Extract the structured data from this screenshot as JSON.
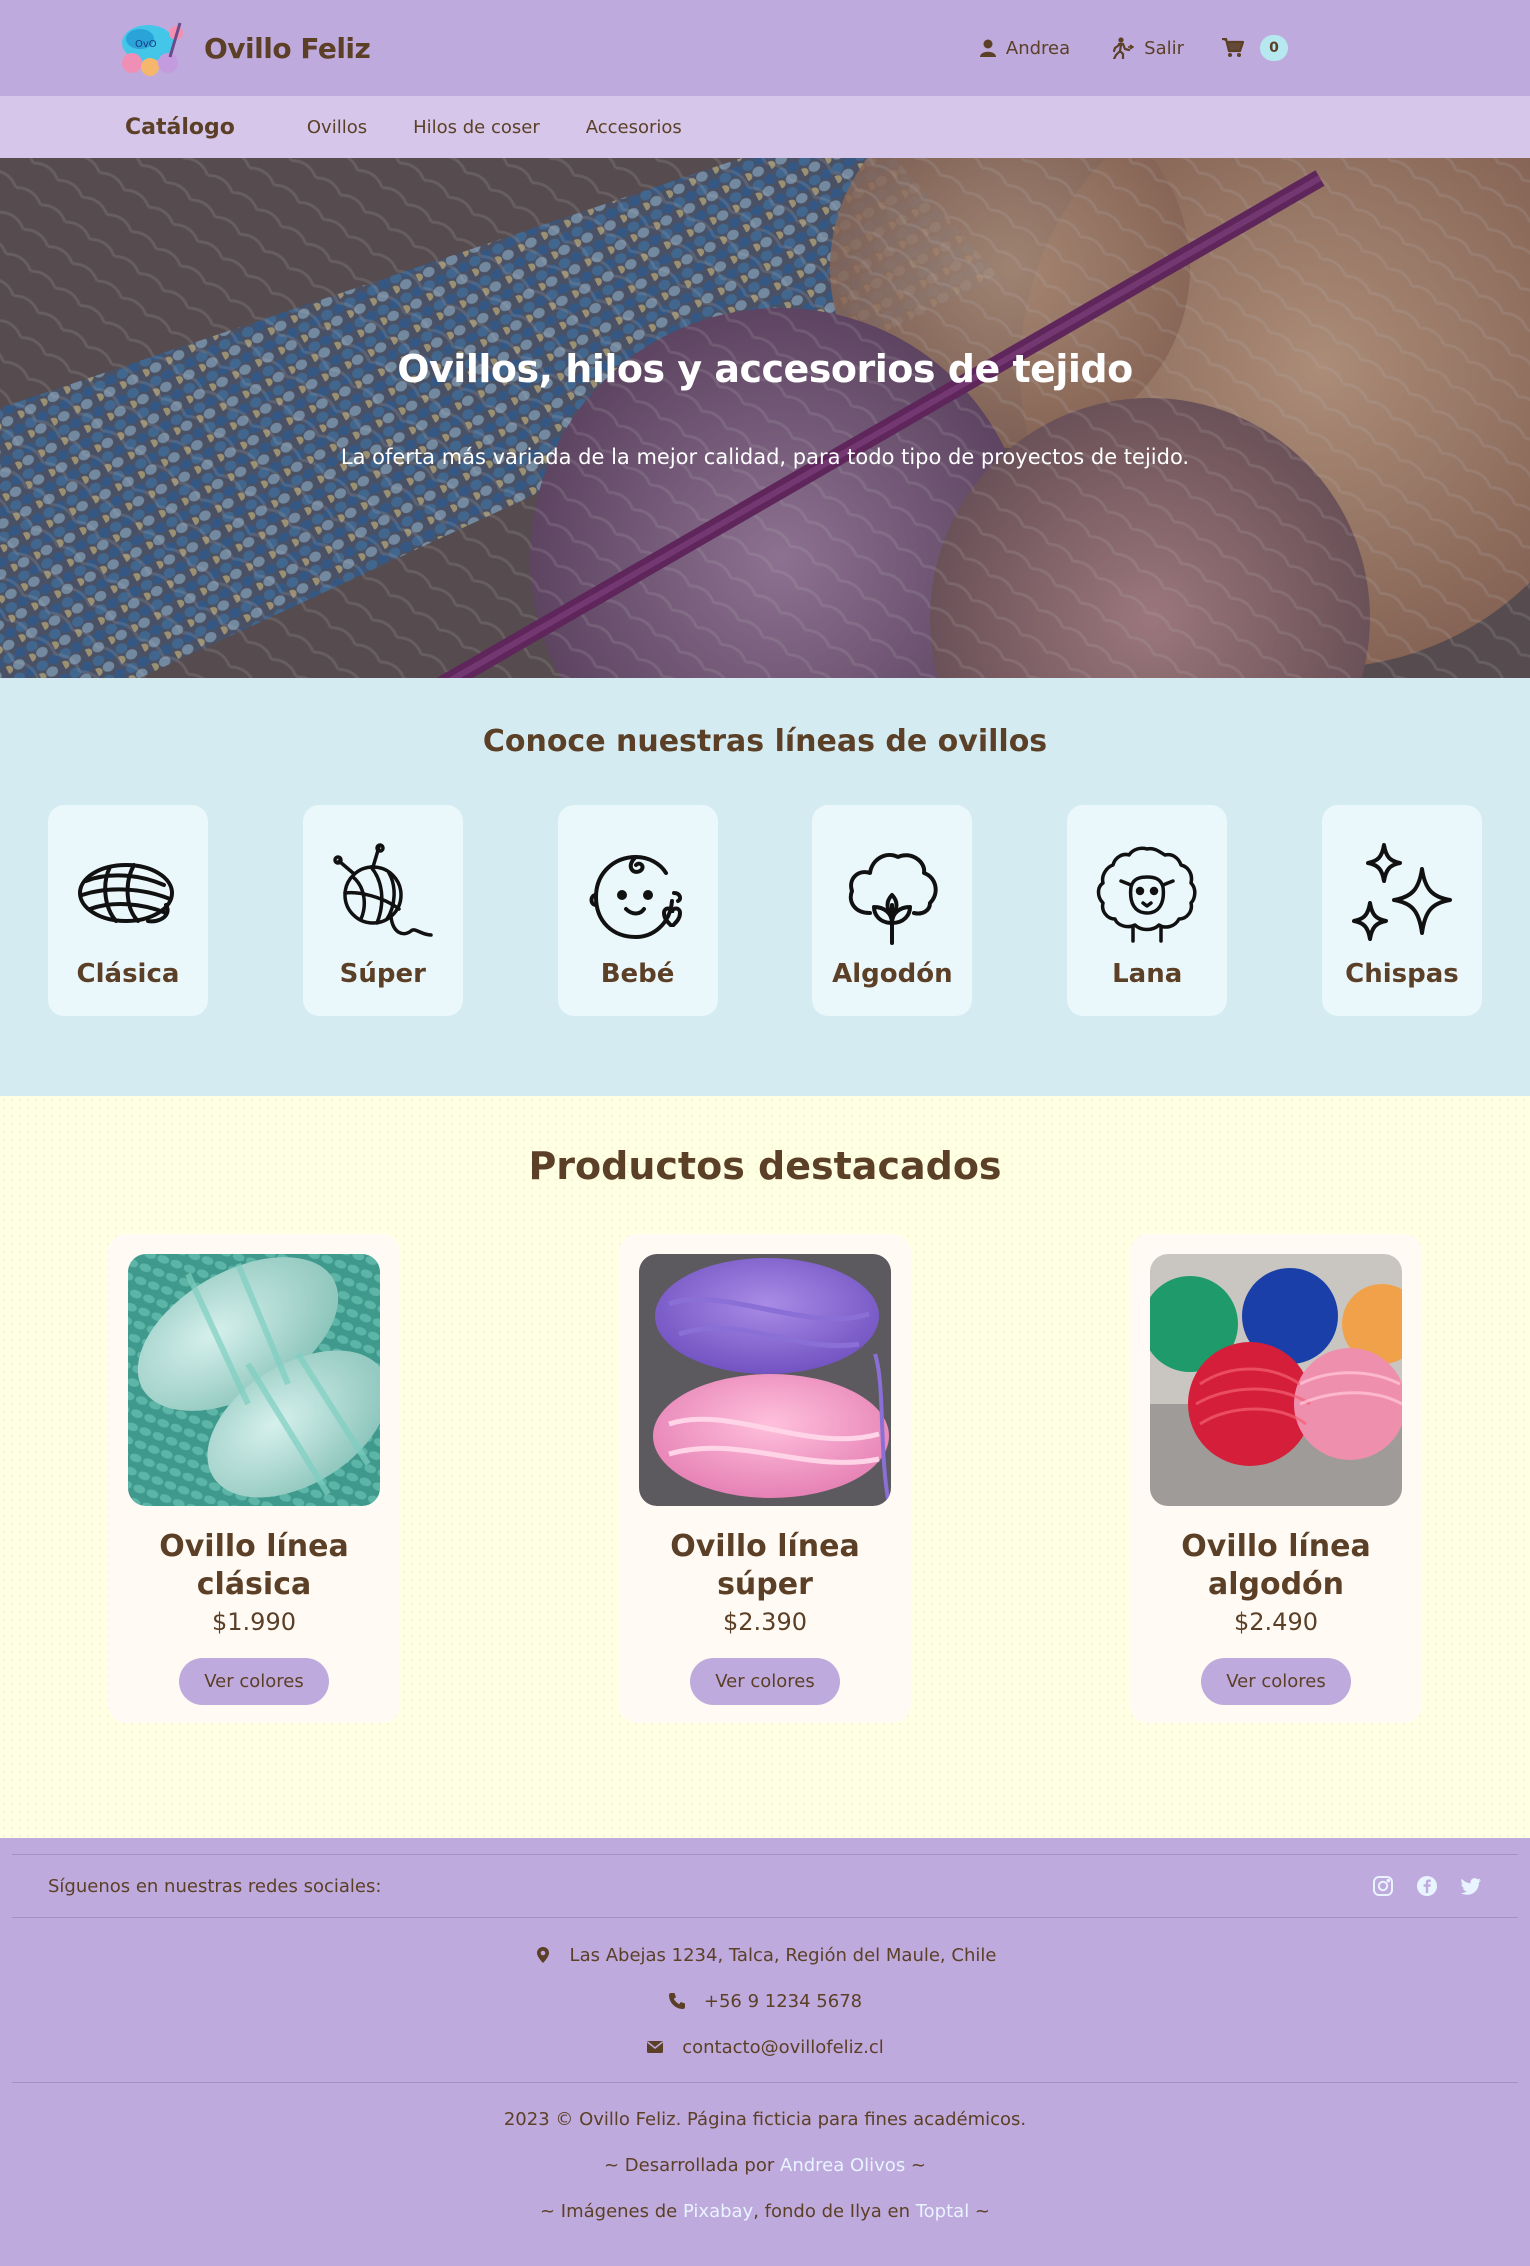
{
  "header": {
    "brand": "Ovillo Feliz",
    "user_label": "Andrea",
    "logout_label": "Salir",
    "cart_count": "0"
  },
  "nav": {
    "title": "Catálogo",
    "links": [
      "Ovillos",
      "Hilos de coser",
      "Accesorios"
    ]
  },
  "hero": {
    "title": "Ovillos, hilos y accesorios de tejido",
    "subtitle": "La oferta más variada de la mejor calidad, para todo tipo de proyectos de tejido."
  },
  "lines": {
    "title": "Conoce nuestras líneas de ovillos",
    "items": [
      {
        "label": "Clásica",
        "icon": "yarn-ball-icon"
      },
      {
        "label": "Súper",
        "icon": "yarn-ball-needle-icon"
      },
      {
        "label": "Bebé",
        "icon": "baby-face-icon"
      },
      {
        "label": "Algodón",
        "icon": "cotton-flower-icon"
      },
      {
        "label": "Lana",
        "icon": "sheep-icon"
      },
      {
        "label": "Chispas",
        "icon": "sparkles-icon"
      }
    ]
  },
  "featured": {
    "title": "Productos destacados",
    "products": [
      {
        "name": "Ovillo línea clásica",
        "price": "$1.990",
        "button": "Ver colores"
      },
      {
        "name": "Ovillo línea súper",
        "price": "$2.390",
        "button": "Ver colores"
      },
      {
        "name": "Ovillo línea algodón",
        "price": "$2.490",
        "button": "Ver colores"
      }
    ]
  },
  "footer": {
    "social_label": "Síguenos en nuestras redes sociales:",
    "social_icons": [
      "instagram-icon",
      "facebook-icon",
      "twitter-icon"
    ],
    "address": "Las Abejas 1234, Talca, Región del Maule, Chile",
    "phone": "+56 9 1234 5678",
    "email": "contacto@ovillofeliz.cl",
    "copyright": "2023 © Ovillo Feliz. Página ficticia para fines académicos.",
    "dev_prefix": "~ Desarrollada por ",
    "dev_name": "Andrea Olivos",
    "dev_suffix": " ~",
    "img_prefix": "~ Imágenes de ",
    "img_source": "Pixabay",
    "img_middle": ", fondo de Ilya en ",
    "img_bg_source": "Toptal",
    "img_suffix": " ~"
  },
  "colors": {
    "header_bg": "#bfaadd",
    "nav_bg": "#d6c7ea",
    "lines_bg": "#d4ebf1",
    "featured_bg": "#ffffe3",
    "text_brown": "#5b3f26",
    "badge_bg": "#b6e8f0"
  }
}
